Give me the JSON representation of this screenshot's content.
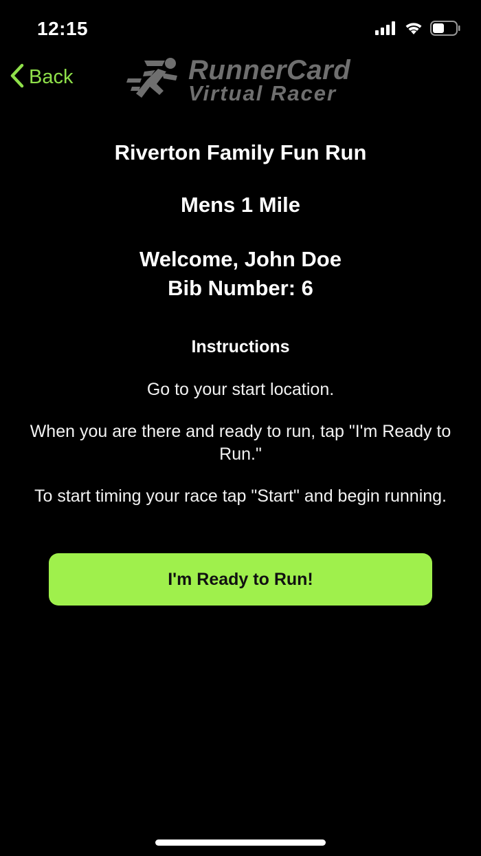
{
  "status_bar": {
    "time": "12:15",
    "icons": [
      "cellular-signal-icon",
      "wifi-icon",
      "battery-icon"
    ]
  },
  "nav": {
    "back_label": "Back",
    "back_icon": "chevron-left-icon",
    "logo_line1": "RunnerCard",
    "logo_line2": "Virtual Racer",
    "logo_icon": "runner-icon"
  },
  "content": {
    "event_title": "Riverton Family Fun Run",
    "race_name": "Mens 1 Mile",
    "welcome": "Welcome, John Doe",
    "bib": "Bib Number: 6",
    "instructions_heading": "Instructions",
    "instructions": [
      "Go to your start location.",
      "When you are there and ready to run, tap \"I'm Ready to Run.\"",
      "To start timing your race tap \"Start\" and begin running."
    ]
  },
  "actions": {
    "ready_label": "I'm Ready to Run!"
  },
  "colors": {
    "accent": "#9ff04c",
    "back_tint": "#8fe04a",
    "background": "#000000",
    "logo_gray": "#6f6f6f"
  }
}
